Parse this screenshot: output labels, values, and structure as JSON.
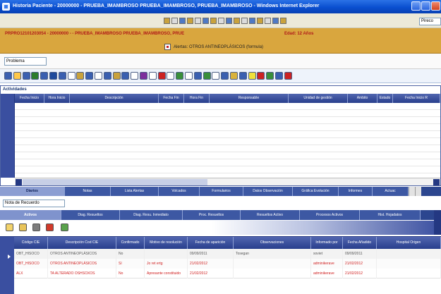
{
  "window": {
    "title": "Historia Paciente - 20000000 - PRUEBA_IMAMBROSO PRUEBA_IMAMBROSO, PRUEBA_IMAMBROSO - Windows Internet Explorer",
    "address_value": "Pireco"
  },
  "patient": {
    "header_line": "PRPRO12101203054 - 20000000 - - PRUEBA_IMAMBROSO PRUEBA_IMAMBROSO, PRUE",
    "age": "Edad: 12 Años",
    "allergy_text": "Alertas: OTROS ANTINEOPLÁSICOS (formula)"
  },
  "section_selector": {
    "value": "Problema"
  },
  "activities_panel": {
    "title": "Actividades",
    "columns": [
      "Fecha Inicio",
      "Hora Inicio",
      "Descripción",
      "Fecha Fin",
      "Hora Fin",
      "Responsable",
      "Unidad de gestión",
      "Ambito",
      "Estado",
      "Fecha Inicio R"
    ]
  },
  "main_tabs": [
    {
      "label": "Diarios",
      "active": true
    },
    {
      "label": "Notas",
      "active": false
    },
    {
      "label": "Lista Alertas",
      "active": false
    },
    {
      "label": "Volcados",
      "active": false
    },
    {
      "label": "Formularios",
      "active": false
    },
    {
      "label": "Datos Observación",
      "active": false
    },
    {
      "label": "Gráfica Evolución",
      "active": false
    },
    {
      "label": "Informes",
      "active": false
    },
    {
      "label": "Actuac",
      "active": false
    }
  ],
  "diag_search": {
    "value": "Nota de Recuerdo"
  },
  "sub_tabs": [
    {
      "label": "Activos",
      "active": true
    },
    {
      "label": "Diag. Resueltos",
      "active": false
    },
    {
      "label": "Diag. Resu. Inmediato",
      "active": false
    },
    {
      "label": "Proc. Resueltos",
      "active": false
    },
    {
      "label": "Resueltos Activo",
      "active": false
    },
    {
      "label": "Procesos Activos",
      "active": false
    },
    {
      "label": "Hist. Hojadatos",
      "active": false
    }
  ],
  "diagnostics": {
    "columns": [
      "Código CIE",
      "Descripción Cod CIE",
      "Confirmado",
      "Motivo de resolución",
      "Fecha de aparición",
      "Observaciones",
      "Informado por",
      "Fecha Añadido",
      "Hospital Origen"
    ],
    "rows": [
      [
        "OBT_HISOCO",
        "OTROS ANTINEOPLÁSICOS",
        "No",
        "",
        "09/09/2011",
        "Tosegan",
        "soviet",
        "09/09/2011",
        ""
      ],
      [
        "OBT_HISOCO",
        "OTROS ANTINEOPLÁSICOS",
        "Sí",
        "Jo ret ertg",
        "21/02/2012",
        "",
        "adminikerave",
        "21/02/2012",
        ""
      ],
      [
        "ALX",
        "TA ALTERADO OSHSOXOS",
        "No",
        "Apresante constituido",
        "21/02/2012",
        "",
        "adminikerave",
        "21/02/2012",
        ""
      ]
    ]
  }
}
